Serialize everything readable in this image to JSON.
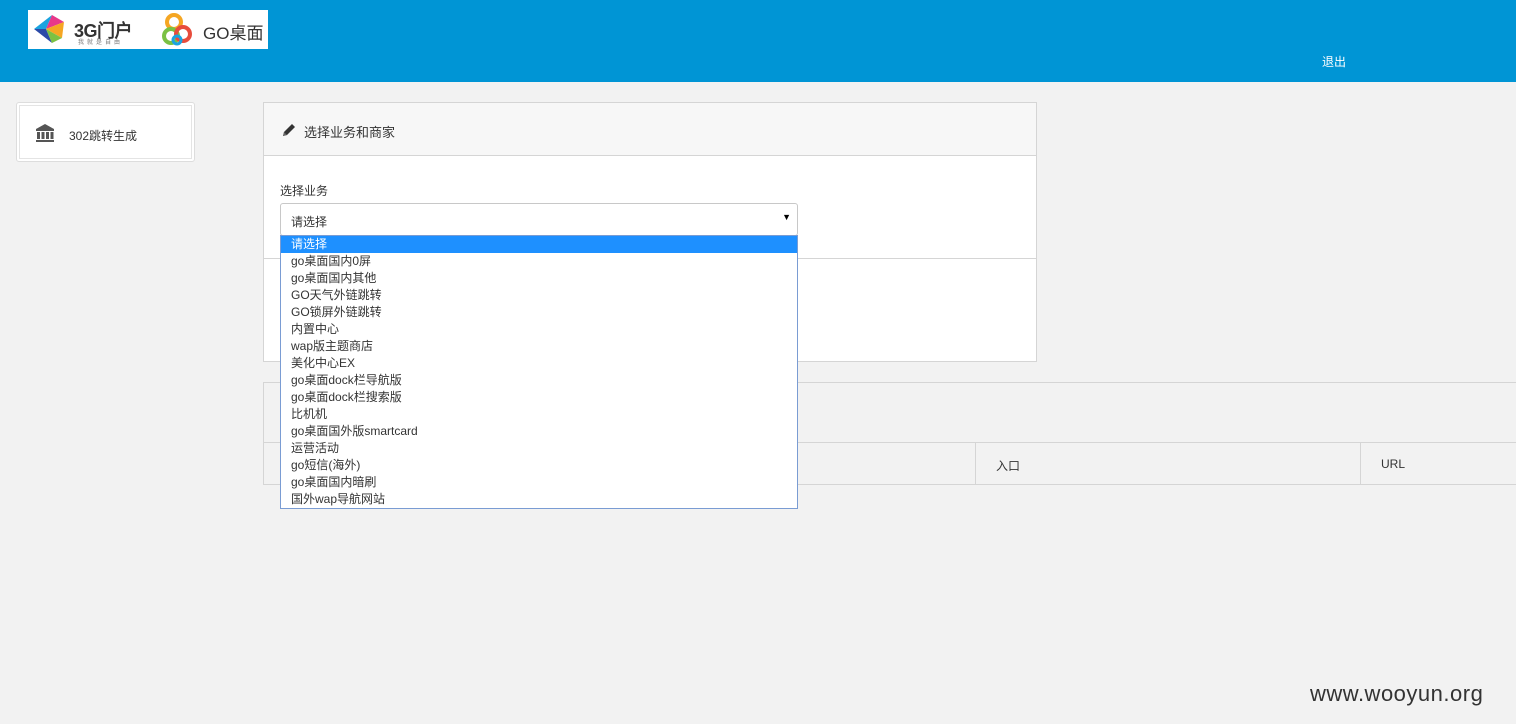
{
  "header": {
    "logo_3g_text": "3G门户",
    "logo_3g_sub": "我就是自由",
    "logo_go_text": "GO桌面",
    "logout_label": "退出",
    "bar_color": "#0095d5"
  },
  "sidebar": {
    "items": [
      {
        "label": "302跳转生成",
        "icon": "bank-icon"
      }
    ]
  },
  "form_panel": {
    "title": "选择业务和商家",
    "title_icon": "pencil-icon",
    "business_label": "选择业务",
    "business_select_value": "请选择"
  },
  "dropdown": {
    "selected_index": 0,
    "options": [
      "请选择",
      "go桌面国内0屏",
      "go桌面国内其他",
      "GO天气外链跳转",
      "GO锁屏外链跳转",
      "内置中心",
      "wap版主题商店",
      "美化中心EX",
      "go桌面dock栏导航版",
      "go桌面dock栏搜索版",
      "比机机",
      "go桌面国外版smartcard",
      "运营活动",
      "go短信(海外)",
      "go桌面国内暗刷",
      "国外wap导航网站"
    ]
  },
  "table": {
    "headers": [
      "",
      "入口",
      "URL"
    ]
  },
  "watermark": "www.wooyun.org"
}
